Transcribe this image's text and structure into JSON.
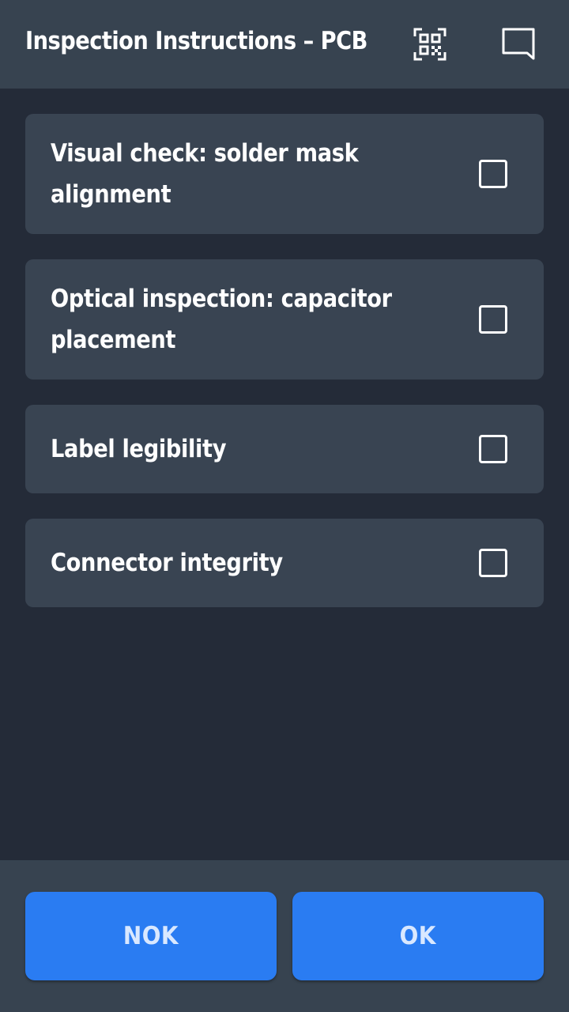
{
  "header": {
    "title": "Inspection Instructions – PCB",
    "icons": [
      "qr-code-icon",
      "chat-icon"
    ]
  },
  "checklist": {
    "items": [
      {
        "label": "Visual check: solder mask alignment",
        "checked": false
      },
      {
        "label": "Optical inspection: capacitor placement",
        "checked": false
      },
      {
        "label": "Label legibility",
        "checked": false
      },
      {
        "label": "Connector integrity",
        "checked": false
      }
    ]
  },
  "actions": {
    "nok_label": "NOK",
    "ok_label": "OK"
  },
  "colors": {
    "background": "#242b38",
    "bar": "#374350",
    "card": "#394452",
    "accent": "#2a7cf2",
    "button_text": "#d9e8ff"
  }
}
